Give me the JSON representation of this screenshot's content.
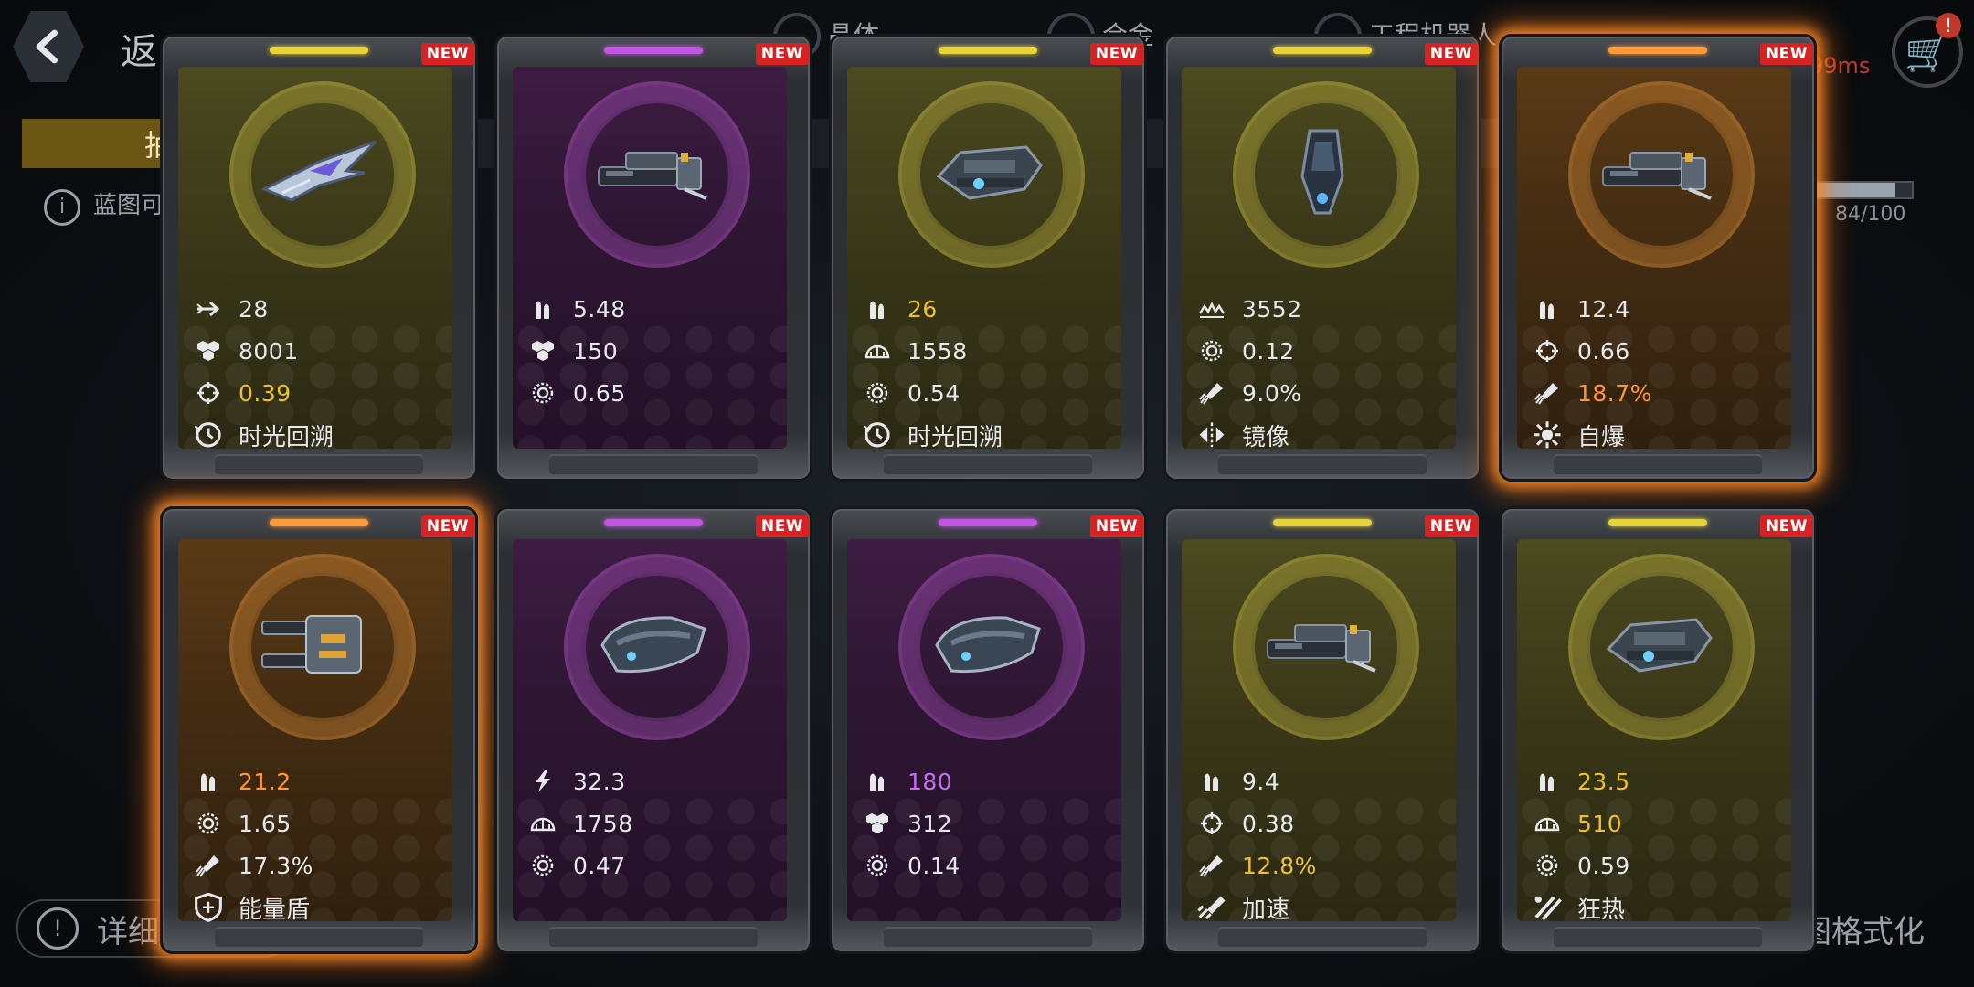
{
  "header": {
    "back_text": "返",
    "resources": [
      "晶体",
      "合金",
      "工程机器人"
    ],
    "ping": "99ms",
    "cart_badge": "!"
  },
  "tabs": {
    "active_label": "抽"
  },
  "info": {
    "text": "蓝图可",
    "icon": "info-icon"
  },
  "progress": {
    "text": "84/100",
    "value": 84,
    "max": 100
  },
  "bottom": {
    "left_label": "详细",
    "right_label": "图格式化"
  },
  "colors": {
    "yellow": "#e6d23a",
    "purple": "#c056e0",
    "orange": "#ff9a3a",
    "new_badge": "#d62222",
    "gold_value": "#f0bf2c",
    "orange_value": "#ff9638",
    "purple_value": "#c46ef0"
  },
  "cards": [
    {
      "rarity": "yellow",
      "glow": false,
      "badge": "NEW",
      "ship": "interceptor",
      "stats": [
        {
          "icon": "speed-icon",
          "value": "28",
          "color": "white"
        },
        {
          "icon": "hull-icon",
          "value": "8001",
          "color": "white"
        },
        {
          "icon": "crosshair-icon",
          "value": "0.39",
          "color": "gold"
        }
      ],
      "skill": {
        "icon": "time-rewind-icon",
        "label": "时光回溯"
      }
    },
    {
      "rarity": "purple",
      "glow": false,
      "badge": "NEW",
      "ship": "cannon",
      "stats": [
        {
          "icon": "ammo-icon",
          "value": "5.48",
          "color": "white"
        },
        {
          "icon": "hull-icon",
          "value": "150",
          "color": "white"
        },
        {
          "icon": "gear-icon",
          "value": "0.65",
          "color": "white"
        }
      ],
      "skill": null
    },
    {
      "rarity": "yellow",
      "glow": false,
      "badge": "NEW",
      "ship": "heavy",
      "stats": [
        {
          "icon": "ammo-icon",
          "value": "26",
          "color": "gold"
        },
        {
          "icon": "shield-arc-icon",
          "value": "1558",
          "color": "white"
        },
        {
          "icon": "gear-icon",
          "value": "0.54",
          "color": "white"
        }
      ],
      "skill": {
        "icon": "time-rewind-icon",
        "label": "时光回溯"
      }
    },
    {
      "rarity": "yellow",
      "glow": false,
      "badge": "NEW",
      "ship": "pod",
      "stats": [
        {
          "icon": "wave-icon",
          "value": "3552",
          "color": "white"
        },
        {
          "icon": "gear-icon",
          "value": "0.12",
          "color": "white"
        },
        {
          "icon": "rocket-icon",
          "value": "9.0%",
          "color": "white"
        }
      ],
      "skill": {
        "icon": "mirror-icon",
        "label": "镜像"
      }
    },
    {
      "rarity": "orange",
      "glow": true,
      "badge": "NEW",
      "ship": "cannon",
      "stats": [
        {
          "icon": "ammo-icon",
          "value": "12.4",
          "color": "white"
        },
        {
          "icon": "crosshair-icon",
          "value": "0.66",
          "color": "white"
        },
        {
          "icon": "rocket-icon",
          "value": "18.7%",
          "color": "orange"
        }
      ],
      "skill": {
        "icon": "explode-icon",
        "label": "自爆"
      }
    },
    {
      "rarity": "orange",
      "glow": true,
      "badge": "NEW",
      "ship": "twin",
      "stats": [
        {
          "icon": "ammo-icon",
          "value": "21.2",
          "color": "orange"
        },
        {
          "icon": "gear-icon",
          "value": "1.65",
          "color": "white"
        },
        {
          "icon": "rocket-icon",
          "value": "17.3%",
          "color": "white"
        }
      ],
      "skill": {
        "icon": "energy-shield-icon",
        "label": "能量盾"
      }
    },
    {
      "rarity": "purple",
      "glow": false,
      "badge": "NEW",
      "ship": "pod-wide",
      "stats": [
        {
          "icon": "bolt-icon",
          "value": "32.3",
          "color": "white"
        },
        {
          "icon": "shield-arc-icon",
          "value": "1758",
          "color": "white"
        },
        {
          "icon": "gear-icon",
          "value": "0.47",
          "color": "white"
        }
      ],
      "skill": null
    },
    {
      "rarity": "purple",
      "glow": false,
      "badge": "NEW",
      "ship": "pod-wide",
      "stats": [
        {
          "icon": "ammo-icon",
          "value": "180",
          "color": "purple"
        },
        {
          "icon": "hull-icon",
          "value": "312",
          "color": "white"
        },
        {
          "icon": "gear-icon",
          "value": "0.14",
          "color": "white"
        }
      ],
      "skill": null
    },
    {
      "rarity": "yellow",
      "glow": false,
      "badge": "NEW",
      "ship": "cannon",
      "stats": [
        {
          "icon": "ammo-icon",
          "value": "9.4",
          "color": "white"
        },
        {
          "icon": "crosshair-icon",
          "value": "0.38",
          "color": "white"
        },
        {
          "icon": "rocket-icon",
          "value": "12.8%",
          "color": "gold"
        }
      ],
      "skill": {
        "icon": "boost-icon",
        "label": "加速"
      }
    },
    {
      "rarity": "yellow",
      "glow": false,
      "badge": "NEW",
      "ship": "heavy",
      "stats": [
        {
          "icon": "ammo-icon",
          "value": "23.5",
          "color": "gold"
        },
        {
          "icon": "shield-arc-icon",
          "value": "510",
          "color": "gold"
        },
        {
          "icon": "gear-icon",
          "value": "0.59",
          "color": "white"
        }
      ],
      "skill": {
        "icon": "frenzy-icon",
        "label": "狂热"
      }
    }
  ]
}
